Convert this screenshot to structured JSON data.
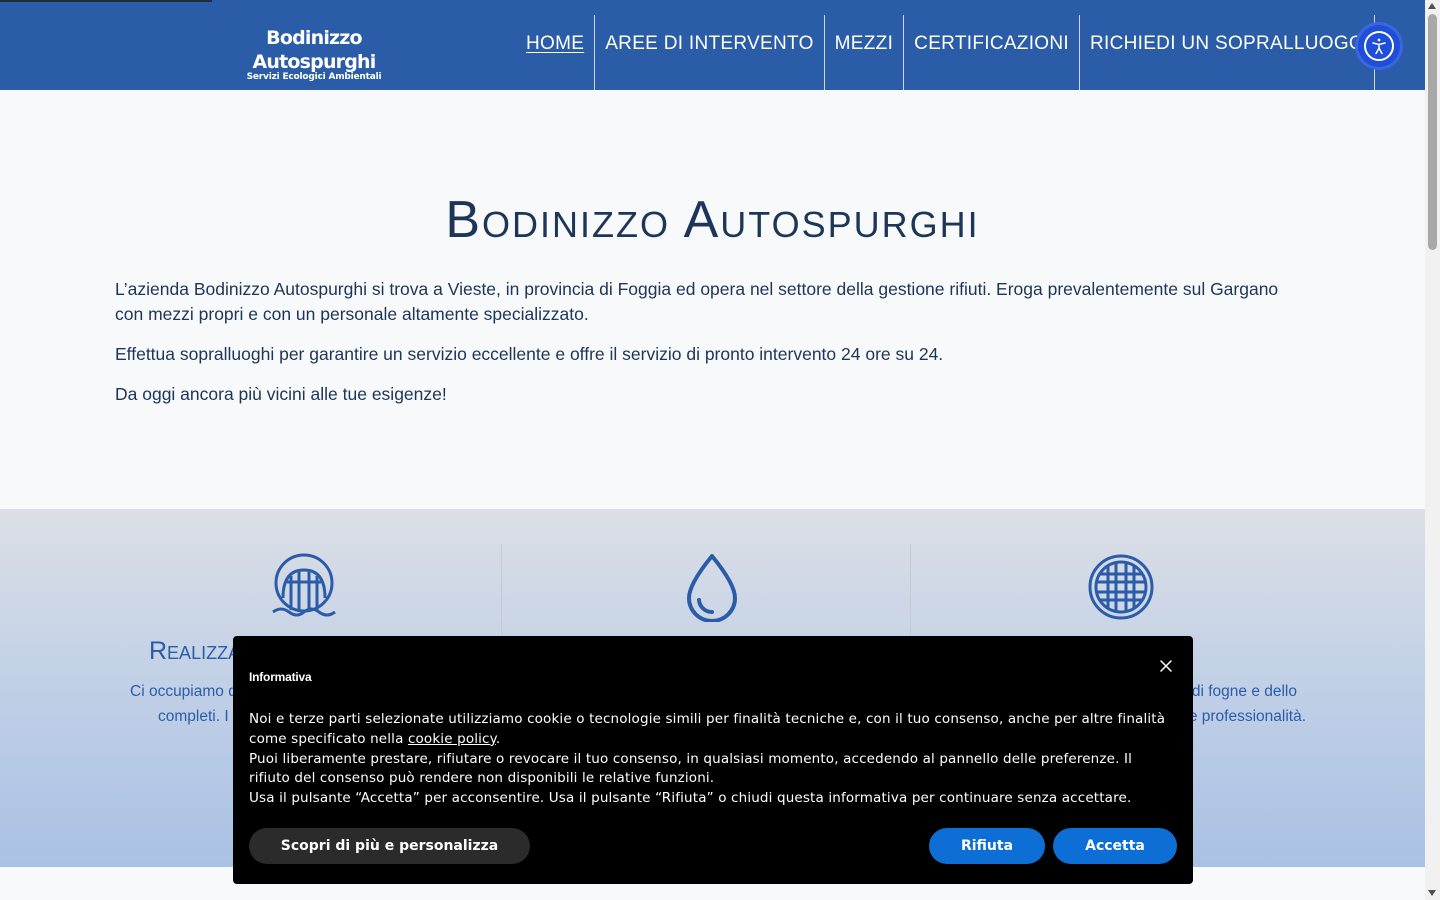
{
  "header": {
    "logo_main": "Bodinizzo Autospurghi",
    "logo_sub": "Servizi Ecologici Ambientali",
    "nav": [
      {
        "label": "HOME",
        "active": true
      },
      {
        "label": "AREE DI INTERVENTO",
        "active": false
      },
      {
        "label": "MEZZI",
        "active": false
      },
      {
        "label": "CERTIFICAZIONI",
        "active": false
      },
      {
        "label": "RICHIEDI UN SOPRALLUOGO",
        "active": false
      }
    ],
    "accessibility_icon": "accessibility-icon"
  },
  "intro": {
    "title": "Bodinizzo Autospurghi",
    "paragraphs": [
      "L’azienda Bodinizzo Autospurghi si trova a Vieste, in provincia di Foggia ed opera nel settore della gestione rifiuti. Eroga prevalentemente sul Gargano con mezzi propri e con un personale altamente specializzato.",
      "Effettua sopralluoghi per garantire un servizio eccellente e offre il servizio di pronto intervento 24 ore su 24.",
      "Da oggi ancora più vicini alle tue esigenze!"
    ]
  },
  "services": {
    "items": [
      {
        "icon": "sewer-pipe-icon",
        "title": "Realizzazio",
        "text_line1": "Ci occupiamo dell",
        "text_line2": "completi. I no"
      },
      {
        "icon": "water-drop-icon",
        "title": "",
        "text_line1": "",
        "text_line2": ""
      },
      {
        "icon": "manhole-grate-icon",
        "title": "",
        "text_line1": "o di fogne e dello",
        "text_line2": "nde professionalità."
      }
    ]
  },
  "cookie_banner": {
    "title": "Informativa",
    "body_1a": "Noi e terze parti selezionate utilizziamo cookie o tecnologie simili per finalità tecniche e, con il tuo consenso, anche per altre finalità come specificato nella ",
    "policy_link": "cookie policy",
    "body_1b": ".",
    "body_2": "Puoi liberamente prestare, rifiutare o revocare il tuo consenso, in qualsiasi momento, accedendo al pannello delle preferenze. Il rifiuto del consenso può rendere non disponibili le relative funzioni.",
    "body_3": "Usa il pulsante “Accetta” per acconsentire. Usa il pulsante “Rifiuta” o chiudi questa informativa per continuare senza accettare.",
    "btn_more": "Scopri di più e personalizza",
    "btn_reject": "Rifiuta",
    "btn_accept": "Accetta"
  },
  "colors": {
    "header_bg": "#2b5ca8",
    "primary_text": "#1d3557",
    "accent_blue": "#0d6fd6",
    "banner_bg": "#000000"
  }
}
